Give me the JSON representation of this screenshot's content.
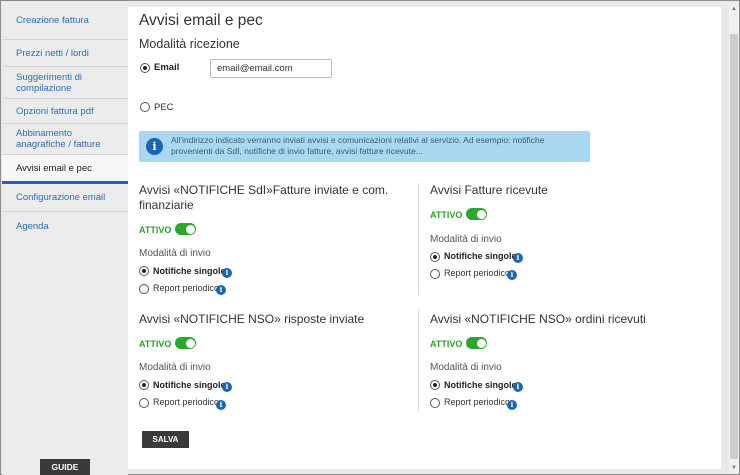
{
  "sidebar": {
    "items": [
      {
        "label": "Creazione fattura",
        "active": false
      },
      {
        "label": "Prezzi netti / lordi",
        "active": false
      },
      {
        "label": "Suggerimenti di compilazione",
        "active": false
      },
      {
        "label": "Opzioni fattura pdf",
        "active": false
      },
      {
        "label": "Abbinamento anagrafiche / fatture",
        "active": false
      },
      {
        "label": "Avvisi email e pec",
        "active": true
      },
      {
        "label": "Configurazione email",
        "active": false
      },
      {
        "label": "Agenda",
        "active": false
      }
    ],
    "guide_label": "GUIDE"
  },
  "main": {
    "title": "Avvisi email e pec",
    "section_title": "Modalità ricezione",
    "email_option": {
      "label": "Email",
      "selected": true
    },
    "email_input": {
      "value": "email@email.com",
      "placeholder": ""
    },
    "pec_option": {
      "label": "PEC",
      "selected": false
    },
    "info_text": "All'indirizzo indicato verranno inviati avvisi e comunicazioni relativi al servizio. Ad esempio: notifiche provenienti da SdI, notifiche di invio fatture, avvisi fatture ricevute...",
    "cards": [
      {
        "title": "Avvisi «NOTIFICHE SdI»Fatture inviate e com. finanziarie",
        "status": "ATTIVO",
        "enabled": true,
        "mode_label": "Modalità di invio",
        "options": [
          {
            "label": "Notifiche singole",
            "selected": true
          },
          {
            "label": "Report periodico",
            "selected": false
          }
        ]
      },
      {
        "title": "Avvisi Fatture ricevute",
        "status": "ATTIVO",
        "enabled": true,
        "mode_label": "Modalità di invio",
        "options": [
          {
            "label": "Notifiche singole",
            "selected": true
          },
          {
            "label": "Report periodico",
            "selected": false
          }
        ]
      },
      {
        "title": "Avvisi «NOTIFICHE NSO» risposte inviate",
        "status": "ATTIVO",
        "enabled": true,
        "mode_label": "Modalità di invio",
        "options": [
          {
            "label": "Notifiche singole",
            "selected": true
          },
          {
            "label": "Report periodico",
            "selected": false
          }
        ]
      },
      {
        "title": "Avvisi «NOTIFICHE NSO» ordini ricevuti",
        "status": "ATTIVO",
        "enabled": true,
        "mode_label": "Modalità di invio",
        "options": [
          {
            "label": "Notifiche singole",
            "selected": true
          },
          {
            "label": "Report periodico",
            "selected": false
          }
        ]
      }
    ],
    "save_label": "SALVA"
  },
  "colors": {
    "link": "#2e6db4",
    "active_tab_border": "#1b63b5",
    "info_bg": "#a9d8f2",
    "toggle_on": "#2ea52e",
    "button_dark": "#3a3a3a"
  }
}
